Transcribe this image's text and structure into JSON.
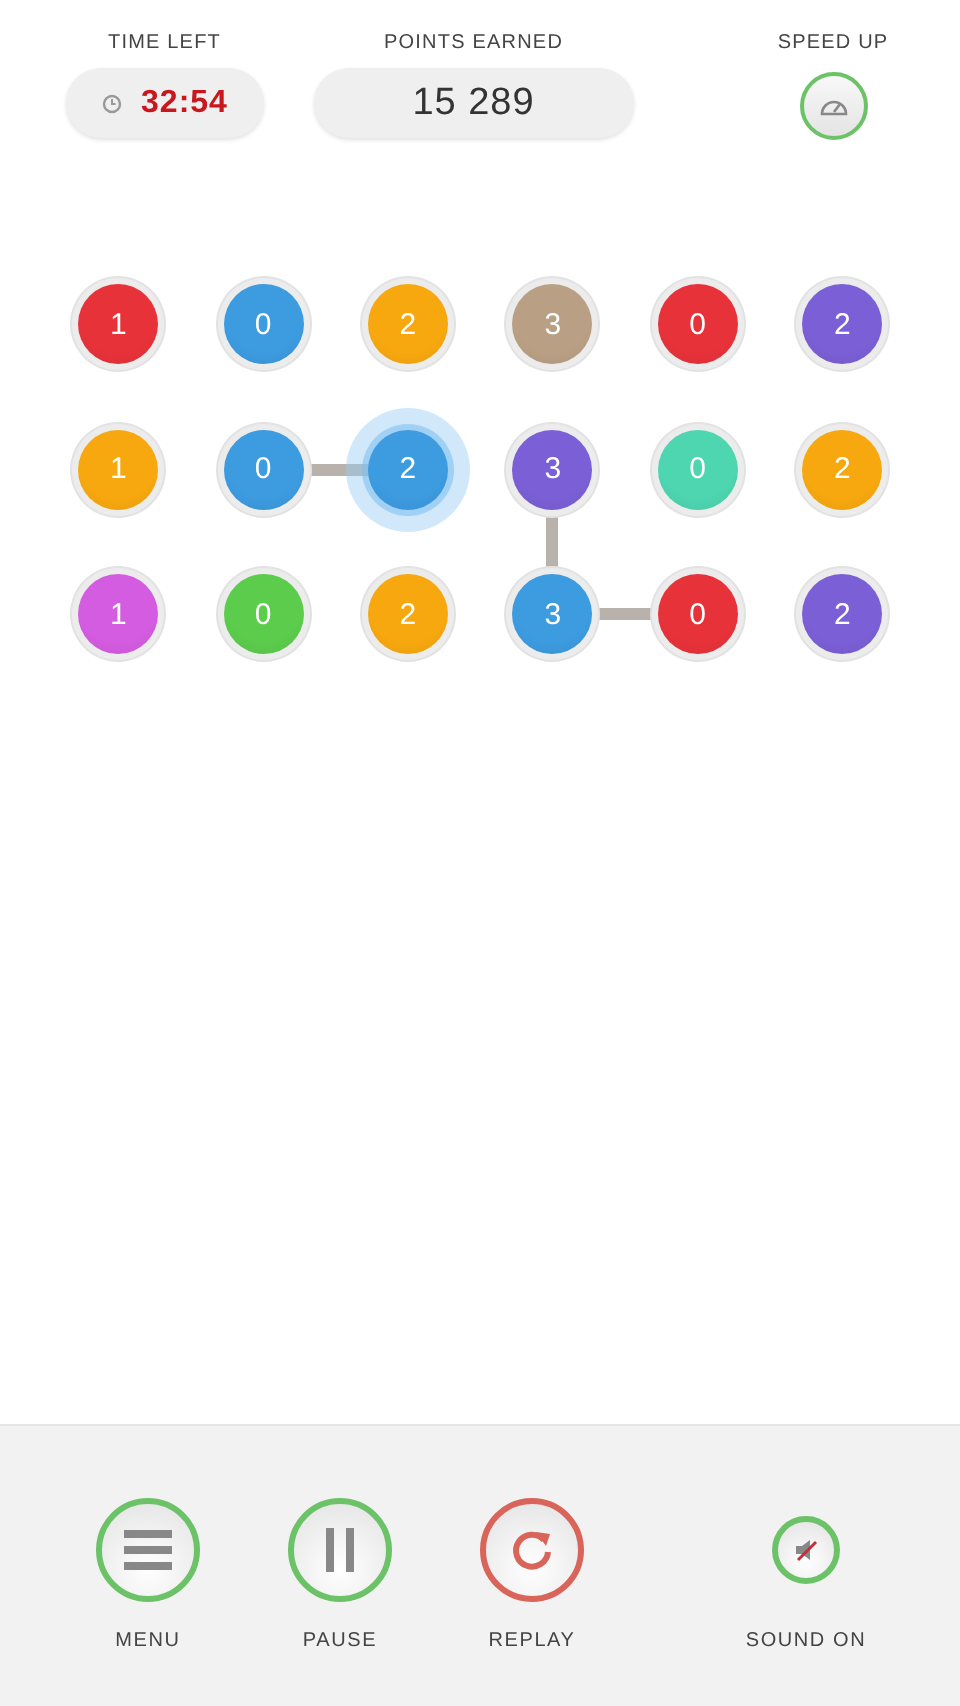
{
  "header": {
    "time_left": {
      "label": "TIME LEFT",
      "value": "32:54"
    },
    "points": {
      "label": "POINTS EARNED",
      "value": "15 289"
    },
    "speed_up": {
      "label": "SPEED UP"
    }
  },
  "grid": [
    [
      {
        "number": "1",
        "color": "#e8323a",
        "selected": false
      },
      {
        "number": "0",
        "color": "#3d9be0",
        "selected": false
      },
      {
        "number": "2",
        "color": "#f8a80f",
        "selected": false
      },
      {
        "number": "3",
        "color": "#b9a085",
        "selected": false
      },
      {
        "number": "0",
        "color": "#e8323a",
        "selected": false
      },
      {
        "number": "2",
        "color": "#7b5fd6",
        "selected": false
      }
    ],
    [
      {
        "number": "1",
        "color": "#f8a80f",
        "selected": false
      },
      {
        "number": "0",
        "color": "#3d9be0",
        "selected": false,
        "link_right": true
      },
      {
        "number": "2",
        "color": "#3d9be0",
        "selected": true
      },
      {
        "number": "3",
        "color": "#7b5fd6",
        "selected": false,
        "link_down": true
      },
      {
        "number": "0",
        "color": "#4dd6b0",
        "selected": false
      },
      {
        "number": "2",
        "color": "#f8a80f",
        "selected": false
      }
    ],
    [
      {
        "number": "1",
        "color": "#d45ce0",
        "selected": false
      },
      {
        "number": "0",
        "color": "#5ccc4c",
        "selected": false
      },
      {
        "number": "2",
        "color": "#f8a80f",
        "selected": false
      },
      {
        "number": "3",
        "color": "#3d9be0",
        "selected": false,
        "link_right": true
      },
      {
        "number": "0",
        "color": "#e8323a",
        "selected": false
      },
      {
        "number": "2",
        "color": "#7b5fd6",
        "selected": false
      }
    ]
  ],
  "toolbar": [
    {
      "kind": "menu",
      "label": "MENU"
    },
    {
      "kind": "pause",
      "label": "PAUSE"
    },
    {
      "kind": "replay",
      "label": "REPLAY"
    },
    {
      "kind": "sound",
      "label": "SOUND ON"
    }
  ]
}
